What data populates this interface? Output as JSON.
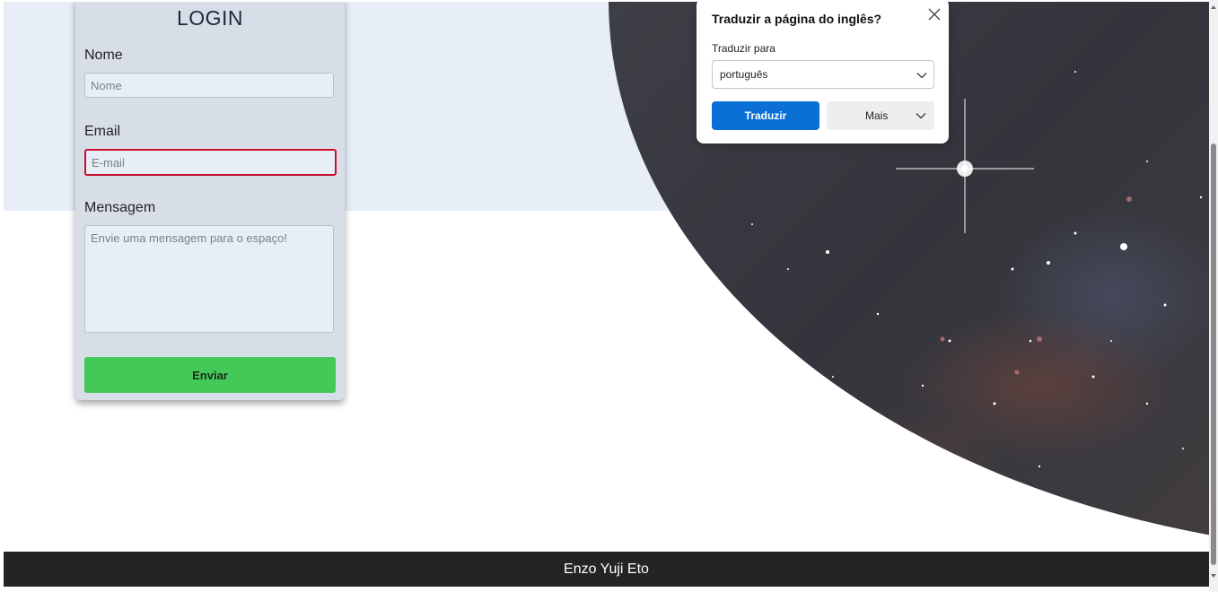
{
  "login": {
    "title": "LOGIN",
    "name_label": "Nome",
    "name_placeholder": "Nome",
    "email_label": "Email",
    "email_placeholder": "E-mail",
    "message_label": "Mensagem",
    "message_placeholder": "Envie uma mensagem para o espaço!",
    "submit_label": "Enviar"
  },
  "translate_popup": {
    "title": "Traduzir a página do inglês?",
    "target_label": "Traduzir para",
    "selected_language": "português",
    "translate_button": "Traduzir",
    "more_button": "Mais"
  },
  "footer": {
    "text": "Enzo Yuji Eto"
  },
  "colors": {
    "submit_green": "#44c958",
    "translate_blue": "#0a70d6",
    "footer_dark": "#242424",
    "error_red": "#c8102e"
  }
}
